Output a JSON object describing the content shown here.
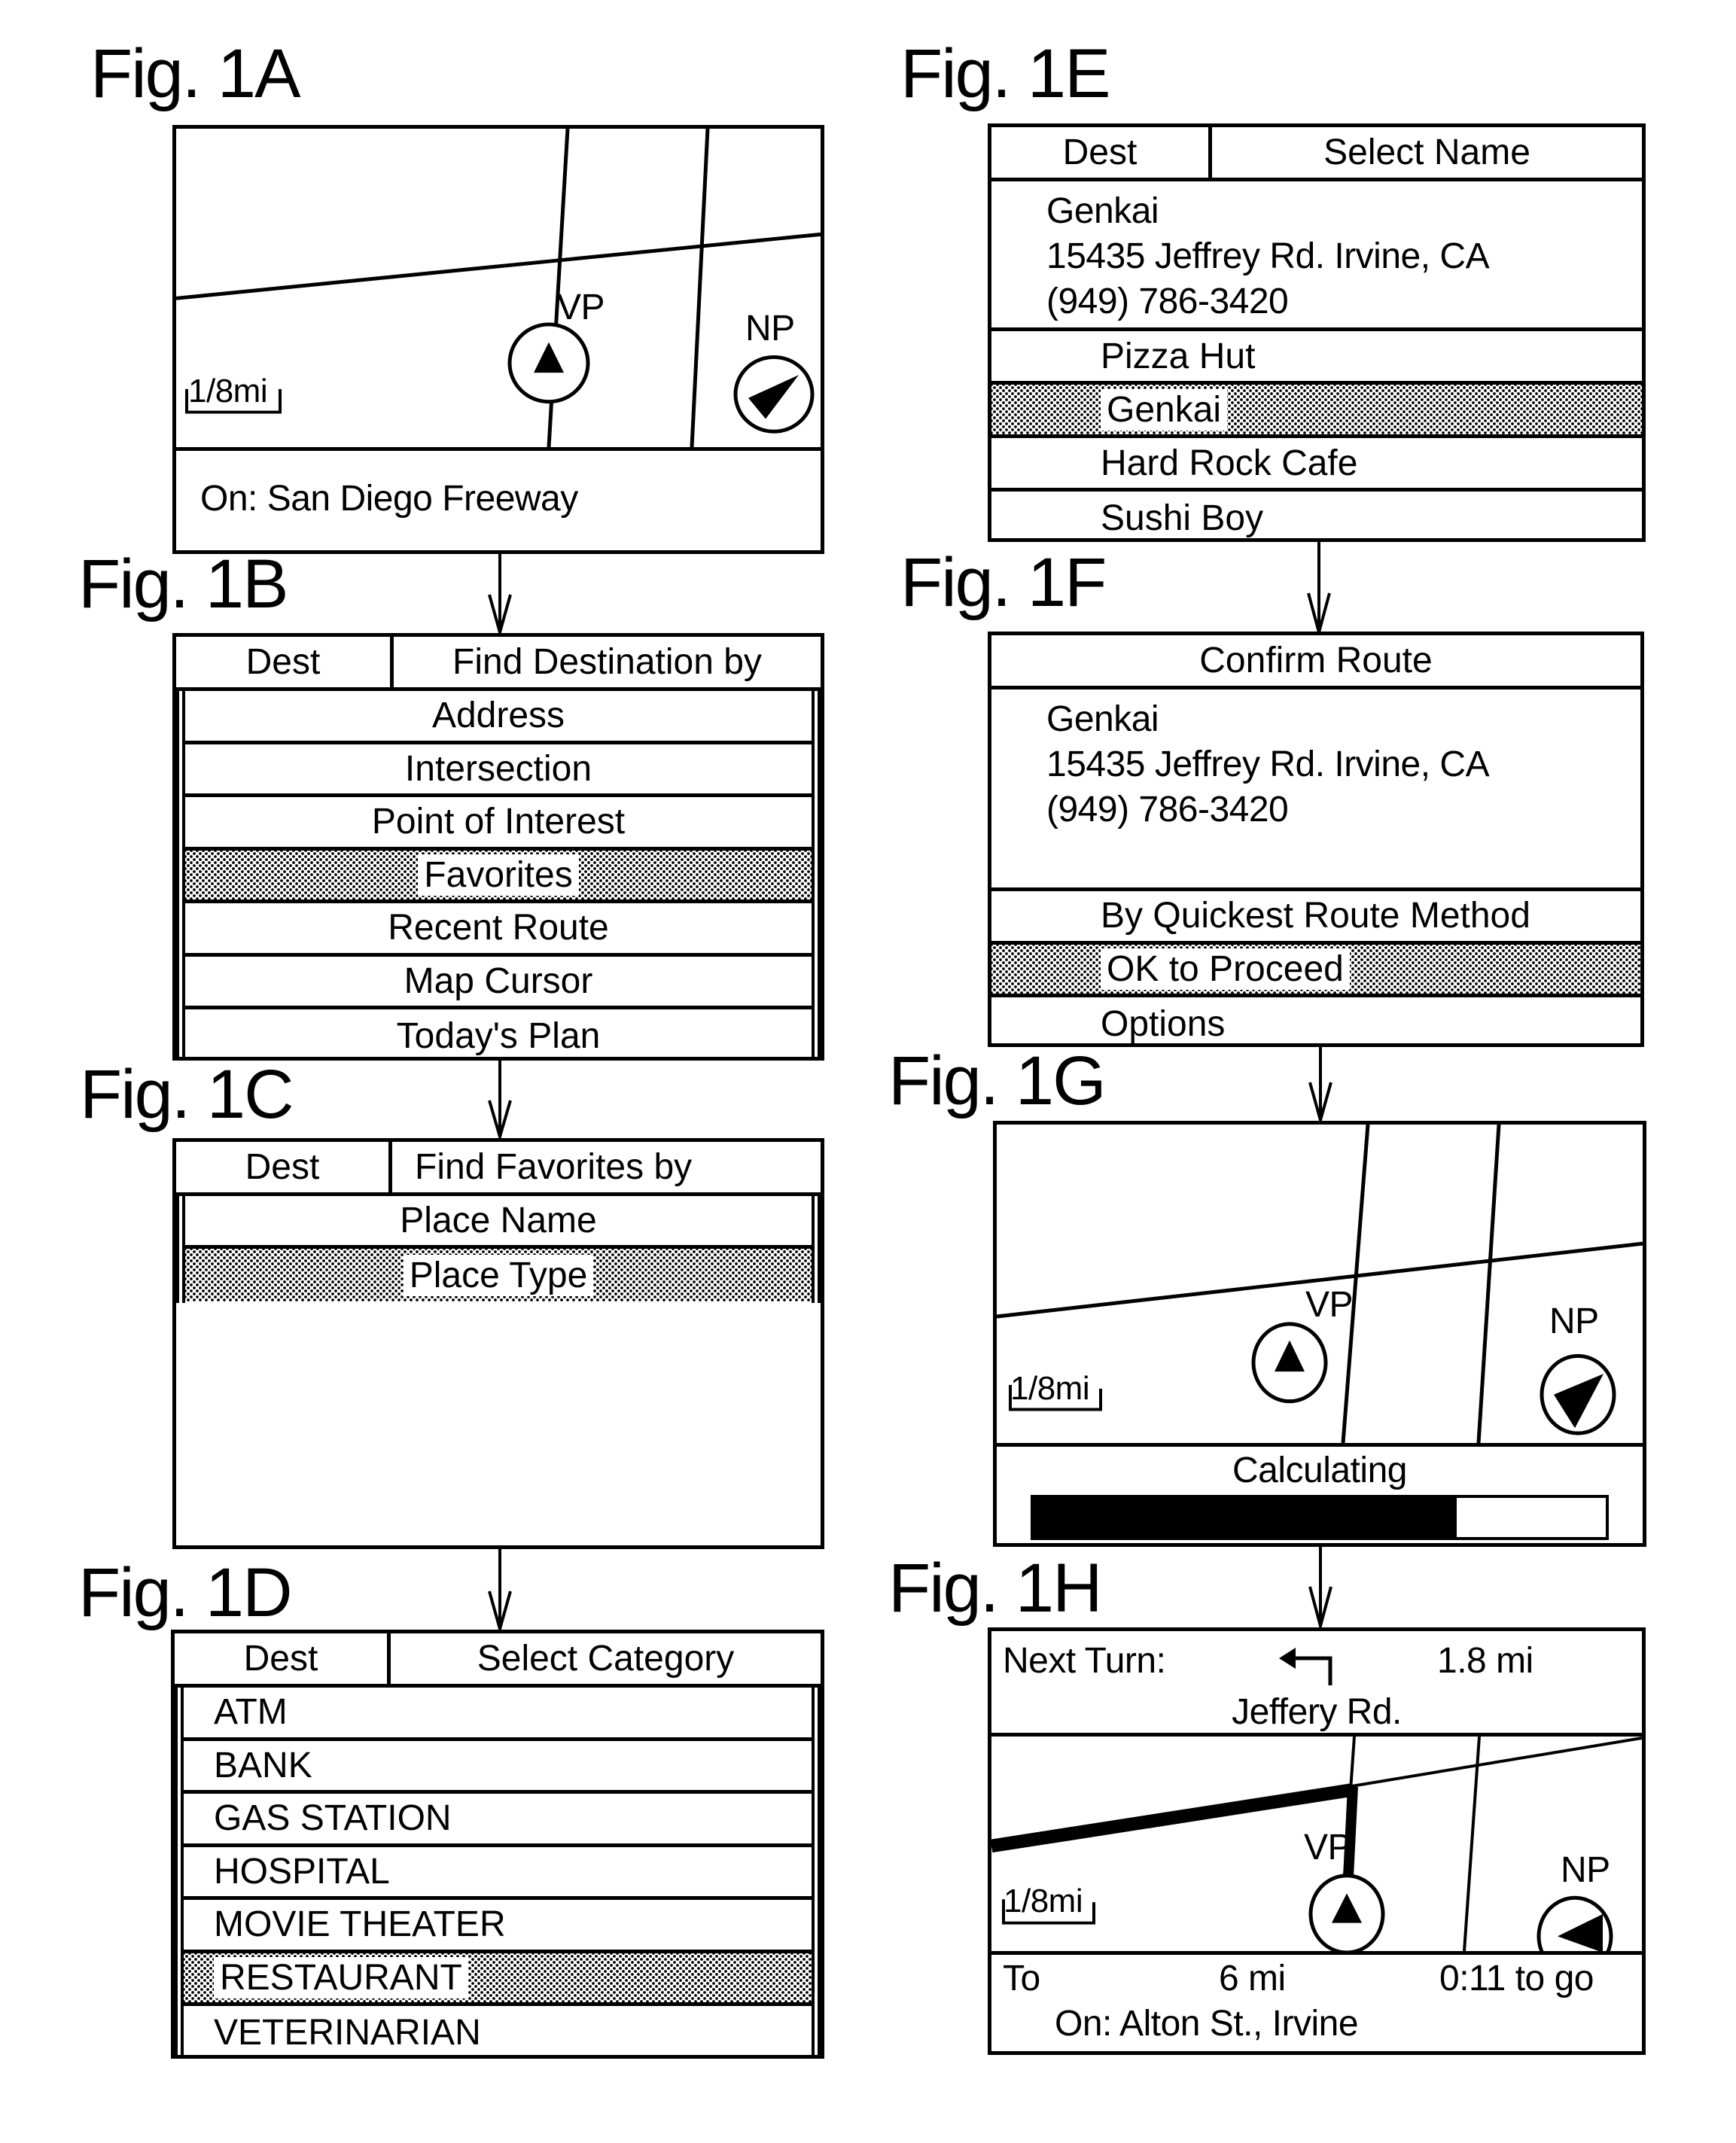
{
  "figures": {
    "fig1a": {
      "label": "Fig. 1A",
      "map": {
        "vehicle_label": "VP",
        "north_label": "NP",
        "scale": "1/8mi"
      },
      "status": "On:  San Diego Freeway"
    },
    "fig1b": {
      "label": "Fig. 1B",
      "header": {
        "left": "Dest",
        "right": "Find Destination by"
      },
      "items": [
        {
          "label": "Address",
          "selected": false
        },
        {
          "label": "Intersection",
          "selected": false
        },
        {
          "label": "Point of Interest",
          "selected": false
        },
        {
          "label": "Favorites",
          "selected": true
        },
        {
          "label": "Recent Route",
          "selected": false
        },
        {
          "label": "Map Cursor",
          "selected": false
        },
        {
          "label": "Today's Plan",
          "selected": false
        }
      ]
    },
    "fig1c": {
      "label": "Fig. 1C",
      "header": {
        "left": "Dest",
        "right": "Find Favorites by"
      },
      "items": [
        {
          "label": "Place Name",
          "selected": false
        },
        {
          "label": "Place Type",
          "selected": true
        }
      ]
    },
    "fig1d": {
      "label": "Fig. 1D",
      "header": {
        "left": "Dest",
        "right": "Select Category"
      },
      "items": [
        {
          "label": "ATM",
          "selected": false
        },
        {
          "label": "BANK",
          "selected": false
        },
        {
          "label": "GAS STATION",
          "selected": false
        },
        {
          "label": "HOSPITAL",
          "selected": false
        },
        {
          "label": "MOVIE THEATER",
          "selected": false
        },
        {
          "label": "RESTAURANT",
          "selected": true
        },
        {
          "label": "VETERINARIAN",
          "selected": false
        }
      ]
    },
    "fig1e": {
      "label": "Fig. 1E",
      "header": {
        "left": "Dest",
        "right": "Select Name"
      },
      "info": {
        "name": "Genkai",
        "address": "15435 Jeffrey Rd. Irvine, CA",
        "phone": "(949) 786-3420"
      },
      "items": [
        {
          "label": "Pizza Hut",
          "selected": false
        },
        {
          "label": "Genkai",
          "selected": true
        },
        {
          "label": "Hard Rock Cafe",
          "selected": false
        },
        {
          "label": "Sushi Boy",
          "selected": false
        }
      ]
    },
    "fig1f": {
      "label": "Fig. 1F",
      "title": "Confirm Route",
      "info": {
        "name": "Genkai",
        "address": "15435 Jeffrey Rd. Irvine, CA",
        "phone": "(949) 786-3420"
      },
      "items": [
        {
          "label": "By Quickest Route Method",
          "selected": false
        },
        {
          "label": "OK to Proceed",
          "selected": true
        },
        {
          "label": "Options",
          "selected": false
        }
      ]
    },
    "fig1g": {
      "label": "Fig. 1G",
      "map": {
        "vehicle_label": "VP",
        "north_label": "NP",
        "scale": "1/8mi"
      },
      "status": "Calculating",
      "progress_percent": 74
    },
    "fig1h": {
      "label": "Fig. 1H",
      "next_turn_label": "Next Turn:",
      "turn_icon": "turn-left-arrow",
      "turn_distance": "1.8 mi",
      "turn_street": "Jeffery Rd.",
      "map": {
        "vehicle_label": "VP",
        "north_label": "NP",
        "scale": "1/8mi"
      },
      "to_label": "To",
      "remaining_distance": "6 mi",
      "time_to_go": "0:11 to go",
      "current_road": "On:  Alton St., Irvine"
    }
  }
}
